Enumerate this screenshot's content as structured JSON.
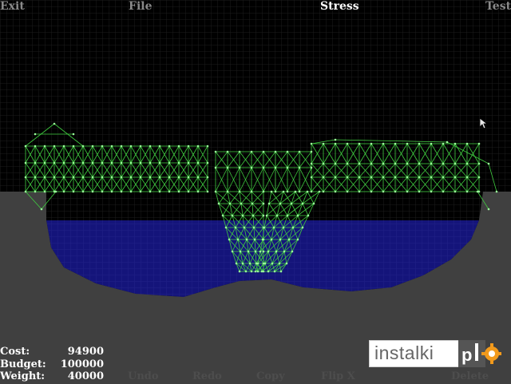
{
  "menu": {
    "exit": "Exit",
    "file": "File",
    "stress": "Stress",
    "test": "Test"
  },
  "bottom_menu": {
    "undo": "Undo",
    "redo": "Redo",
    "copy": "Copy",
    "flip_x": "Flip X",
    "delete": "Delete"
  },
  "stats": {
    "cost_label": "Cost:",
    "cost_value": "94900",
    "budget_label": "Budget:",
    "budget_value": "100000",
    "weight_label": "Weight:",
    "weight_value": "40000"
  },
  "watermark": {
    "text": "instalki",
    "logo": "pl-gear-logo"
  },
  "colors": {
    "background": "#000000",
    "grid": "#1c1c1c",
    "ground": "#404040",
    "water": "#14147a",
    "truss": "#33cc33",
    "joint": "#8fff8f"
  }
}
